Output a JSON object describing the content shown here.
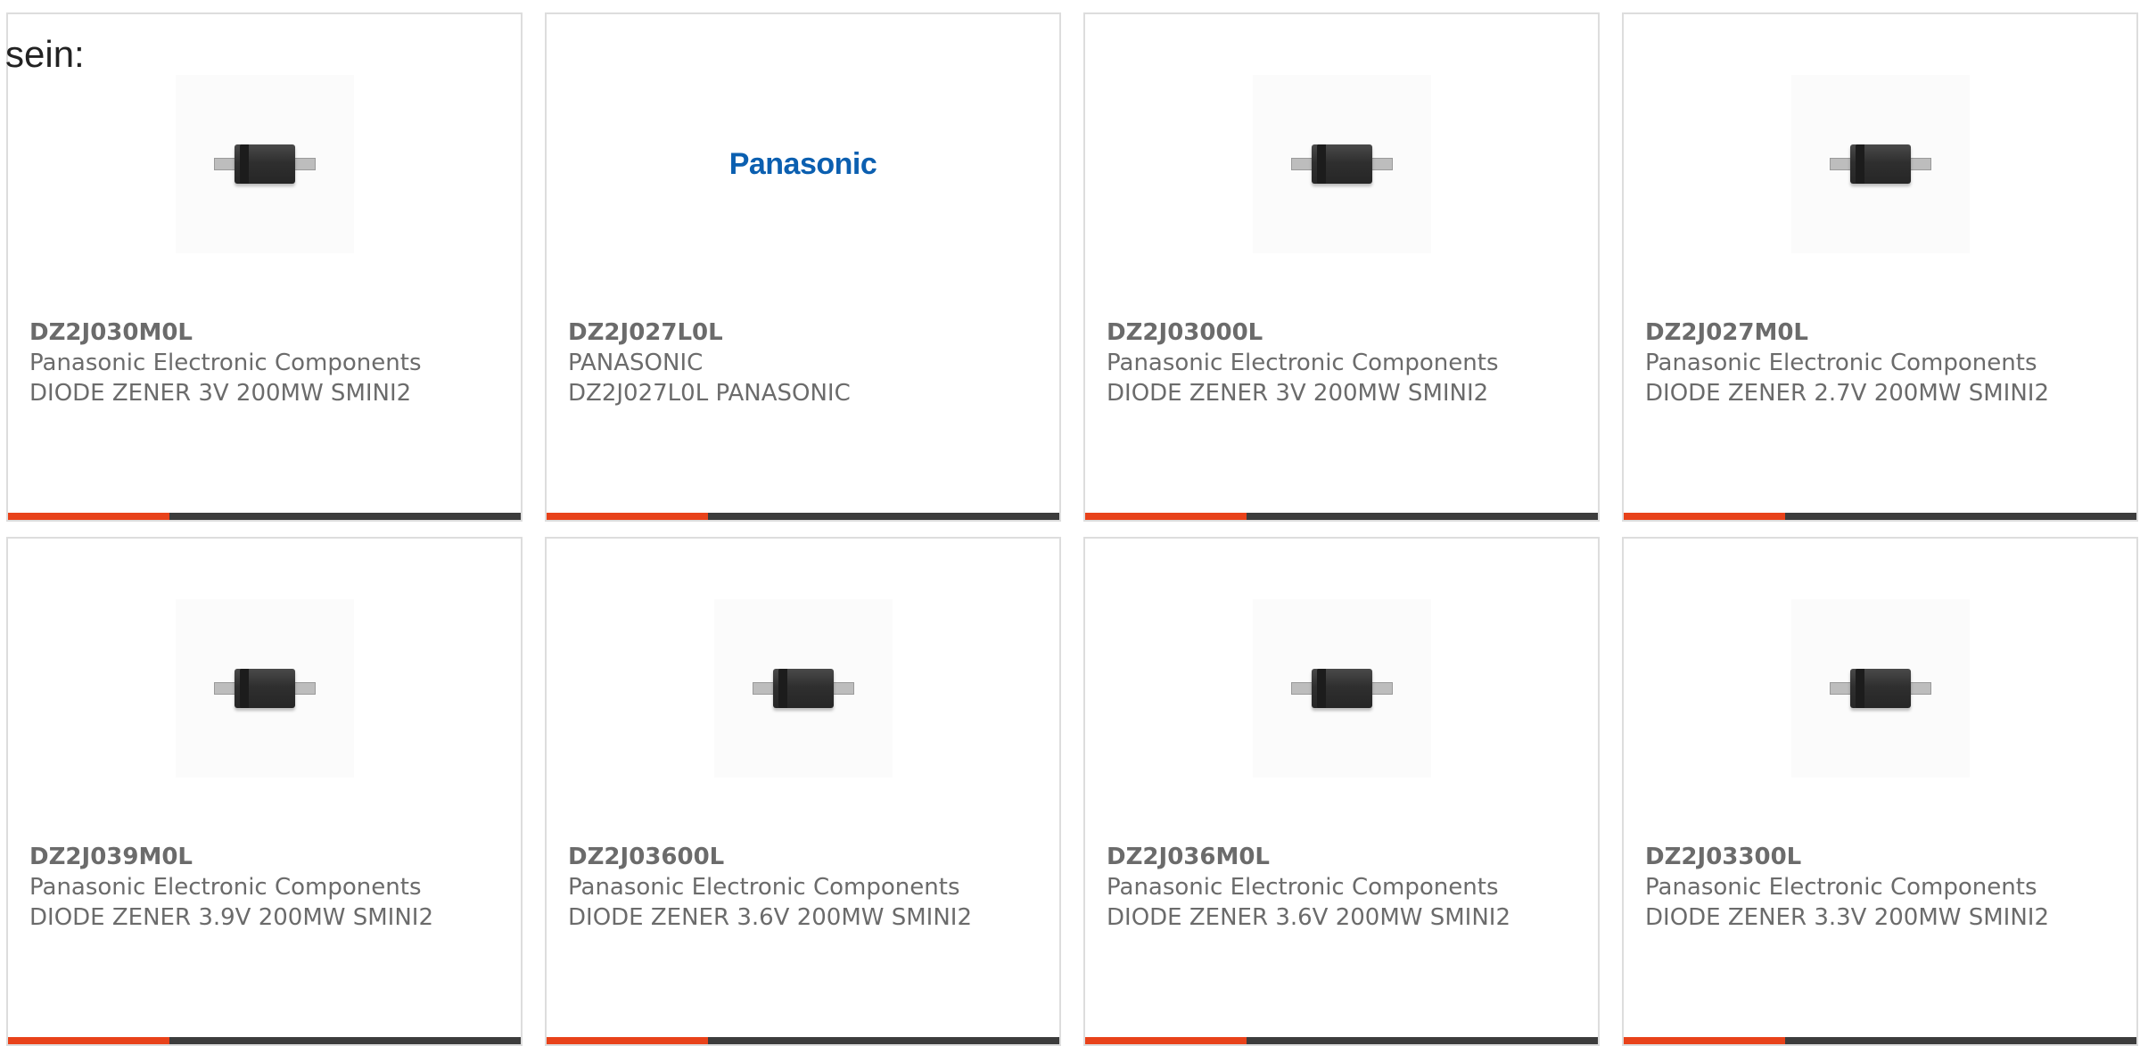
{
  "intro": {
    "text": "sein:"
  },
  "colors": {
    "accent": "#e8421a",
    "bar": "#3c3c3c",
    "text": "#6b6b6b",
    "border": "#dddddd",
    "logo": "#0b5fb0"
  },
  "products": [
    {
      "part_number": "DZ2J030M0L",
      "manufacturer": "Panasonic Electronic Components",
      "description": "DIODE ZENER 3V 200MW SMINI2",
      "image": "diode-chip-icon"
    },
    {
      "part_number": "DZ2J027L0L",
      "manufacturer": "PANASONIC",
      "description": "DZ2J027L0L PANASONIC",
      "image": "panasonic-logo",
      "logo_text": "Panasonic"
    },
    {
      "part_number": "DZ2J03000L",
      "manufacturer": "Panasonic Electronic Components",
      "description": "DIODE ZENER 3V 200MW SMINI2",
      "image": "diode-chip-icon"
    },
    {
      "part_number": "DZ2J027M0L",
      "manufacturer": "Panasonic Electronic Components",
      "description": "DIODE ZENER 2.7V 200MW SMINI2",
      "image": "diode-chip-icon"
    },
    {
      "part_number": "DZ2J039M0L",
      "manufacturer": "Panasonic Electronic Components",
      "description": "DIODE ZENER 3.9V 200MW SMINI2",
      "image": "diode-chip-icon"
    },
    {
      "part_number": "DZ2J03600L",
      "manufacturer": "Panasonic Electronic Components",
      "description": "DIODE ZENER 3.6V 200MW SMINI2",
      "image": "diode-chip-icon"
    },
    {
      "part_number": "DZ2J036M0L",
      "manufacturer": "Panasonic Electronic Components",
      "description": "DIODE ZENER 3.6V 200MW SMINI2",
      "image": "diode-chip-icon"
    },
    {
      "part_number": "DZ2J03300L",
      "manufacturer": "Panasonic Electronic Components",
      "description": "DIODE ZENER 3.3V 200MW SMINI2",
      "image": "diode-chip-icon"
    }
  ]
}
